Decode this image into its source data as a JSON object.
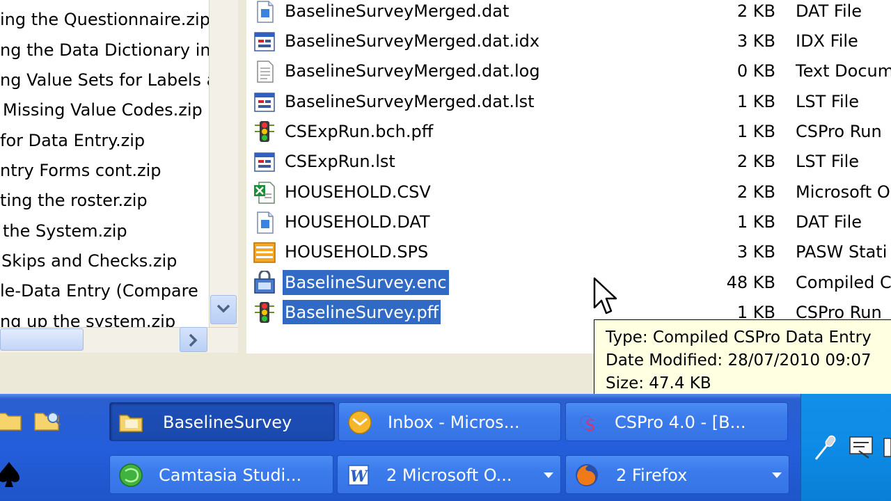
{
  "left_tree": {
    "items": [
      {
        "label": "ing the Questionnaire.zip"
      },
      {
        "label": "ng the Data Dictionary in C"
      },
      {
        "label": "ng Value Sets for Labels a"
      },
      {
        "label": "Missing Value Codes.zip"
      },
      {
        "label": "for Data Entry.zip"
      },
      {
        "label": "ntry Forms cont.zip"
      },
      {
        "label": "ting the roster.zip"
      },
      {
        "label": "the System.zip"
      },
      {
        "label": "Skips and Checks.zip"
      },
      {
        "label": "le-Data Entry (Compare"
      },
      {
        "label": "ng up the system.zip"
      }
    ]
  },
  "files": [
    {
      "name": "BaselineSurveyMerged.dat",
      "size": "2 KB",
      "type": "DAT File",
      "icon": "document-icon",
      "selected": false
    },
    {
      "name": "BaselineSurveyMerged.dat.idx",
      "size": "3 KB",
      "type": "IDX File",
      "icon": "generic-file-icon",
      "selected": false
    },
    {
      "name": "BaselineSurveyMerged.dat.log",
      "size": "0 KB",
      "type": "Text Docum",
      "icon": "text-file-icon",
      "selected": false
    },
    {
      "name": "BaselineSurveyMerged.dat.lst",
      "size": "1 KB",
      "type": "LST File",
      "icon": "generic-file-icon",
      "selected": false
    },
    {
      "name": "CSExpRun.bch.pff",
      "size": "1 KB",
      "type": "CSPro Run",
      "icon": "traffic-light-icon",
      "selected": false
    },
    {
      "name": "CSExpRun.lst",
      "size": "2 KB",
      "type": "LST File",
      "icon": "generic-file-icon",
      "selected": false
    },
    {
      "name": "HOUSEHOLD.CSV",
      "size": "2 KB",
      "type": "Microsoft O",
      "icon": "excel-file-icon",
      "selected": false
    },
    {
      "name": "HOUSEHOLD.DAT",
      "size": "1 KB",
      "type": "DAT File",
      "icon": "document-icon",
      "selected": false
    },
    {
      "name": "HOUSEHOLD.SPS",
      "size": "3 KB",
      "type": "PASW Stati",
      "icon": "spss-file-icon",
      "selected": false
    },
    {
      "name": "BaselineSurvey.enc",
      "size": "48 KB",
      "type": "Compiled C",
      "icon": "compiled-entry-icon",
      "selected": true
    },
    {
      "name": "BaselineSurvey.pff",
      "size": "1 KB",
      "type": "CSPro Run",
      "icon": "traffic-light-icon",
      "selected": true
    }
  ],
  "tooltip": {
    "type_line": "Type: Compiled CSPro Data Entry",
    "date_line": "Date Modified: 28/07/2010 09:07",
    "size_line": "Size: 47.4 KB"
  },
  "taskbar": {
    "row1": [
      {
        "label": "BaselineSurvey",
        "icon": "folder-icon",
        "active": true
      },
      {
        "label": "Inbox - Micros...",
        "icon": "outlook-icon",
        "active": false
      },
      {
        "label": "CSPro 4.0 - [B...",
        "icon": "cspro-icon",
        "active": false
      }
    ],
    "row2": [
      {
        "label": "Camtasia Studi...",
        "icon": "camtasia-icon",
        "active": false,
        "group": false
      },
      {
        "label": "2  Microsoft O...",
        "icon": "word-icon",
        "active": false,
        "group": true
      },
      {
        "label": "2  Firefox",
        "icon": "firefox-icon",
        "active": false,
        "group": true
      }
    ]
  },
  "colors": {
    "selection": "#316ac5",
    "taskbar": "#245edb",
    "tooltip_bg": "#ffffe1",
    "tray": "#0d8be6"
  }
}
